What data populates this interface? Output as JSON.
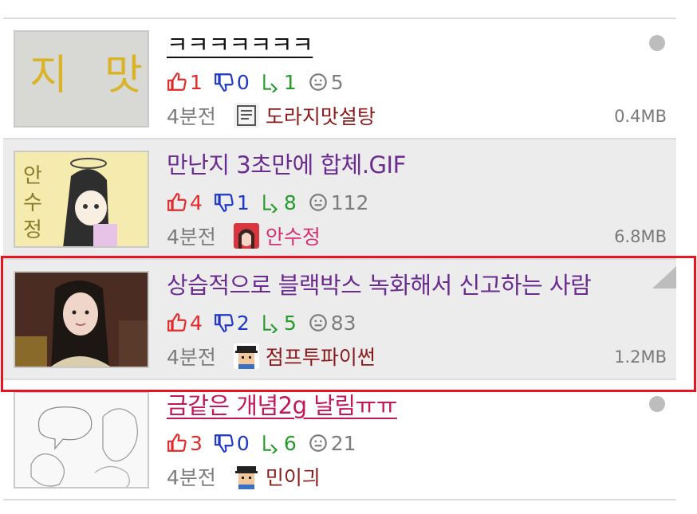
{
  "posts": [
    {
      "title": "ㅋㅋㅋㅋㅋㅋㅋ",
      "likes": "1",
      "dislikes": "0",
      "shares": "1",
      "views": "5",
      "time": "4분전",
      "author": "도라지맛설탕",
      "size": "0.4MB",
      "thumb_text": "지 맛"
    },
    {
      "title": "만난지 3초만에 합체.GIF",
      "likes": "4",
      "dislikes": "1",
      "shares": "8",
      "views": "112",
      "time": "4분전",
      "author": "안수정",
      "size": "6.8MB",
      "thumb_text": "안수정"
    },
    {
      "title": "상습적으로 블랙박스 녹화해서 신고하는 사람",
      "likes": "4",
      "dislikes": "2",
      "shares": "5",
      "views": "83",
      "time": "4분전",
      "author": "점프투파이썬",
      "size": "1.2MB"
    },
    {
      "title": "금같은 개념2g 날림ㅠㅠ",
      "likes": "3",
      "dislikes": "0",
      "shares": "6",
      "views": "21",
      "time": "4분전",
      "author": "민이긔"
    }
  ],
  "colors": {
    "like": "#e32a2a",
    "dislike": "#1f38c8",
    "share": "#279a2d",
    "highlight": "#e8141f"
  }
}
